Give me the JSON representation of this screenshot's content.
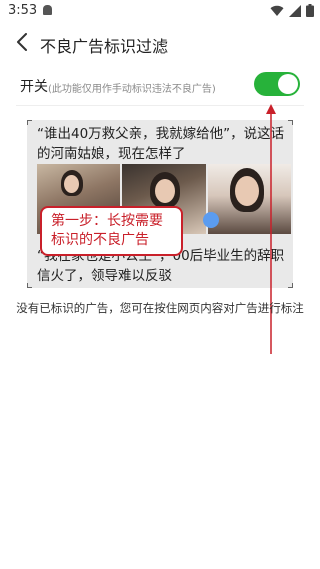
{
  "status_bar": {
    "time": "3:53"
  },
  "header": {
    "title": "不良广告标识过滤"
  },
  "switch_row": {
    "label": "开关",
    "hint": "(此功能仅用作手动标识违法不良广告)",
    "enabled": true
  },
  "demo": {
    "headline": "“谁出40万救父亲，我就嫁给他”，说这话的河南姑娘，现在怎样了",
    "subline": "“我在家也是小公主”，00后毕业生的辞职信火了，领导难以反驳",
    "callout": "第一步：长按需要标识的不良广告"
  },
  "empty_tip": "没有已标识的广告，您可在按住网页内容对广告进行标注",
  "colors": {
    "toggle_on": "#27b23a",
    "callout_red": "#c9202a",
    "touch_blue": "#5b9cf0"
  },
  "icons": {
    "back": "back-arrow-icon",
    "wifi": "wifi-icon",
    "signal": "signal-icon",
    "battery": "battery-icon"
  }
}
